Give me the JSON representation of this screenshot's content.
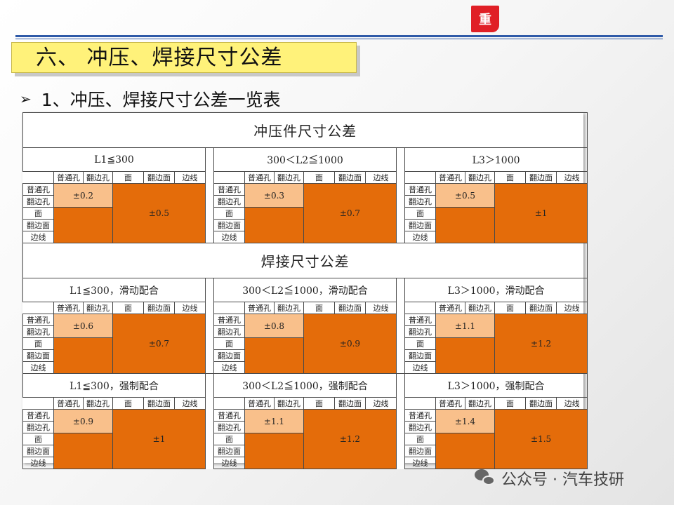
{
  "header": {
    "logo_text": "重",
    "title": "六、 冲压、焊接尺寸公差"
  },
  "subtitle": {
    "text": "1、冲压、焊接尺寸公差一览表"
  },
  "sheet": {
    "column_labels": [
      "普通孔",
      "翻边孔",
      "面",
      "翻边面",
      "边线"
    ],
    "row_labels": [
      "普通孔",
      "翻边孔",
      "面",
      "翻边面",
      "边线"
    ],
    "sections": [
      {
        "title": "冲压件尺寸公差",
        "bands": [
          {
            "categories": [
              "L1≦300",
              "300＜L2≦1000",
              "L3＞1000"
            ],
            "small": [
              "±0.2",
              "±0.3",
              "±0.5"
            ],
            "large": [
              "±0.5",
              "±0.7",
              "±1"
            ]
          }
        ]
      },
      {
        "title": "焊接尺寸公差",
        "bands": [
          {
            "categories": [
              "L1≦300，滑动配合",
              "300＜L2≦1000，滑动配合",
              "L3＞1000，滑动配合"
            ],
            "small": [
              "±0.6",
              "±0.8",
              "±1.1"
            ],
            "large": [
              "±0.7",
              "±0.9",
              "±1.2"
            ]
          },
          {
            "categories": [
              "L1≦300，强制配合",
              "300＜L2≦1000，强制配合",
              "L3＞1000，强制配合"
            ],
            "small": [
              "±0.9",
              "±1.1",
              "±1.4"
            ],
            "large": [
              "±1",
              "±1.2",
              "±1.5"
            ]
          }
        ]
      }
    ]
  },
  "watermark": {
    "text": "公众号 · 汽车技研"
  },
  "colors": {
    "dark_cell": "#e46c0a",
    "light_cell": "#f9c08b",
    "title_box": "#fff27a",
    "rule_line": "#2f5aa8",
    "logo": "#e01f26"
  }
}
